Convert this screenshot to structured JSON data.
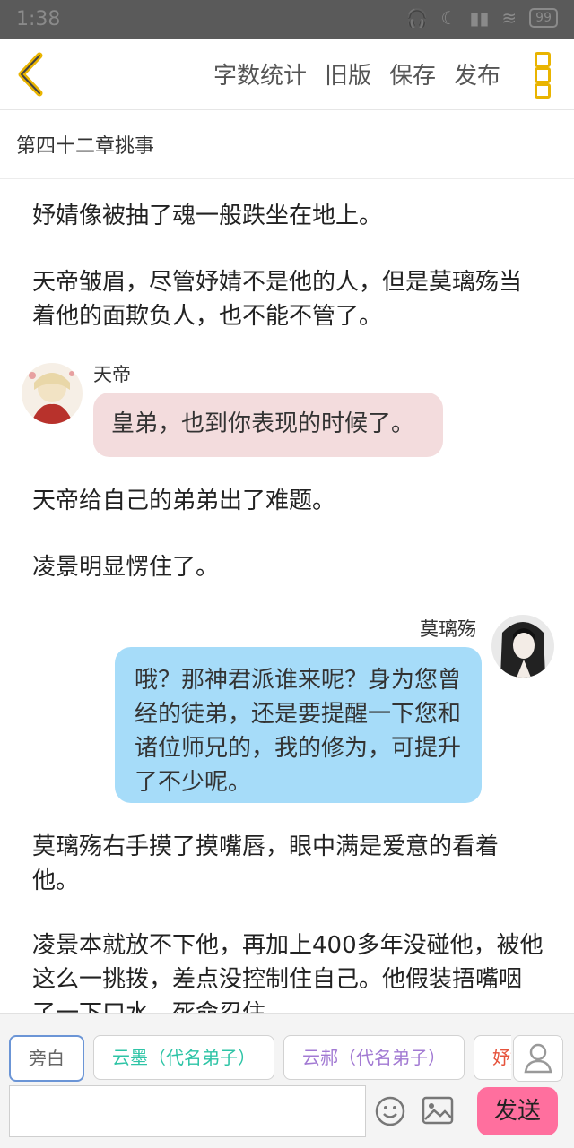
{
  "status": {
    "time": "1:38",
    "battery": "99"
  },
  "toolbar": {
    "word_count": "字数统计",
    "old_version": "旧版",
    "save": "保存",
    "publish": "发布"
  },
  "chapter": {
    "title": "第四十二章挑事"
  },
  "content": {
    "p1": "妤婧像被抽了魂一般跌坐在地上。",
    "p2": "天帝皱眉，尽管妤婧不是他的人，但是莫璃殇当着他的面欺负人，也不能不管了。",
    "msg1": {
      "speaker": "天帝",
      "text": "皇弟，也到你表现的时候了。"
    },
    "p3": "天帝给自己的弟弟出了难题。",
    "p4": "凌景明显愣住了。",
    "msg2": {
      "speaker": "莫璃殇",
      "text": "哦？那神君派谁来呢？身为您曾经的徒弟，还是要提醒一下您和诸位师兄的，我的修为，可提升了不少呢。"
    },
    "p5": "莫璃殇右手摸了摸嘴唇，眼中满是爱意的看着他。",
    "p6": "凌景本就放不下他，再加上400多年没碰他，被他这么一挑拨，差点没控制住自己。他假装捂嘴咽了一下口水，死命忍住。"
  },
  "bottom": {
    "chips": [
      "旁白",
      "云墨（代名弟子）",
      "云郝（代名弟子）",
      "妤婧"
    ],
    "input_placeholder": "",
    "send": "发送"
  },
  "colors": {
    "accent_send": "#ff6f9e",
    "bubble_left": "#f3dcdd",
    "bubble_right": "#a6dcf9",
    "menu_icon": "#e9b400"
  }
}
